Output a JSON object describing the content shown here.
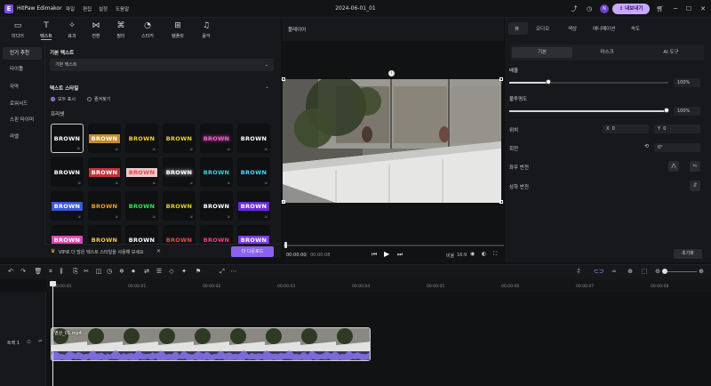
{
  "app": {
    "name": "HitPaw Edimakor",
    "menu": [
      "파일",
      "편집",
      "설정",
      "도움말"
    ],
    "doc_title": "2024-06-01_01",
    "avatar_initial": "N",
    "export_label": "내보내기"
  },
  "tool_tabs": [
    {
      "label": "미디어",
      "icon": "media-icon"
    },
    {
      "label": "텍스트",
      "icon": "text-icon",
      "active": true
    },
    {
      "label": "효과",
      "icon": "effects-icon"
    },
    {
      "label": "전환",
      "icon": "transition-icon"
    },
    {
      "label": "필터",
      "icon": "filter-icon"
    },
    {
      "label": "스티커",
      "icon": "sticker-icon"
    },
    {
      "label": "템플릿",
      "icon": "template-icon"
    },
    {
      "label": "음악",
      "icon": "music-icon"
    }
  ],
  "categories": [
    "인기 추천",
    "타이틀",
    "자막",
    "로워서드",
    "스핀 타이머",
    "라벨"
  ],
  "text_panel": {
    "basic_title": "기본 텍스트",
    "basic_value": "기본 텍스트",
    "style_title": "텍스트 스타일",
    "radio_all": "모두 표시",
    "radio_fav": "즐겨찾기",
    "preset_title": "프리셋",
    "preset_text": "BROWN",
    "vip_text": "VIP로 더 많은 텍스트 스타일을 사용해 보세요",
    "more_label": "더 다운로드"
  },
  "presets": [
    {
      "color": "#ffffff",
      "bg": "#0f1012",
      "glow": false
    },
    {
      "color": "#ffffff",
      "bg": "#c58a2c",
      "glow": false
    },
    {
      "color": "#f5d23a",
      "bg": "#0f1012",
      "glow": false
    },
    {
      "color": "#f0d530",
      "bg": "#0f1012",
      "glow": false
    },
    {
      "color": "#f05ac8",
      "bg": "#0f1012",
      "glow": true
    },
    {
      "color": "#ffffff",
      "bg": "#0f1012",
      "glow": false
    },
    {
      "color": "#ffffff",
      "bg": "#0f1012",
      "glow": false
    },
    {
      "color": "#ffffff",
      "bg": "#c0353a",
      "glow": false
    },
    {
      "color": "#e04a4a",
      "bg": "#f0c8c8",
      "glow": false
    },
    {
      "color": "#ffffff",
      "bg": "#0f1012",
      "glow": true
    },
    {
      "color": "#30d8e8",
      "bg": "#0f1012",
      "glow": false
    },
    {
      "color": "#5ad0ff",
      "bg": "#0f1012",
      "glow": false
    },
    {
      "color": "#ffffff",
      "bg": "#3a58d8",
      "glow": false
    },
    {
      "color": "#f0a020",
      "bg": "#0f1012",
      "glow": false
    },
    {
      "color": "#3fe050",
      "bg": "#0f1012",
      "glow": false
    },
    {
      "color": "#e8d030",
      "bg": "#0f1012",
      "glow": false
    },
    {
      "color": "#ffffff",
      "bg": "#0f1012",
      "glow": false
    },
    {
      "color": "#ffffff",
      "bg": "#6a2ad8",
      "glow": false
    },
    {
      "color": "#ffffff",
      "bg": "#d84ab0",
      "glow": false
    },
    {
      "color": "#f0d040",
      "bg": "#0f1012",
      "glow": false
    },
    {
      "color": "#ffffff",
      "bg": "#0f1012",
      "glow": false
    },
    {
      "color": "#e05050",
      "bg": "#0f1012",
      "glow": false
    },
    {
      "color": "#ff3a8a",
      "bg": "#0f1012",
      "glow": false
    },
    {
      "color": "#ffffff",
      "bg": "#7a3ae8",
      "glow": false
    }
  ],
  "player": {
    "title": "플레이어",
    "time_current": "00:00:00",
    "time_total": "00:00:08",
    "ratio_label": "비율",
    "ratio_value": "16:9",
    "progress": 0.0
  },
  "inspector": {
    "tabs": [
      "뷰",
      "오디오",
      "색상",
      "애니메이션",
      "속도"
    ],
    "sub_tabs": [
      "기본",
      "마스크",
      "AI 도구"
    ],
    "scale_label": "배율",
    "scale_value": "100%",
    "scale_fraction": 1.0,
    "opacity_label": "불투명도",
    "opacity_value": "100%",
    "opacity_fraction": 1.0,
    "position_label": "위치",
    "x_label": "X",
    "x_value": "0",
    "y_label": "Y",
    "y_value": "0",
    "rotate_label": "회전",
    "rotate_value": "0°",
    "flip_h_label": "좌우 반전",
    "flip_v_label": "상하 반전",
    "reset_label": "초기화"
  },
  "timeline": {
    "ticks": [
      "00:00:00",
      "00:00:01",
      "00:00:02",
      "00:00:03",
      "00:00:04",
      "00:00:05",
      "00:00:06",
      "00:00:07",
      "00:00:08"
    ],
    "track_label": "트랙 1",
    "clip_name": "영상_01.mp4"
  },
  "colors": {
    "accent": "#b995ff",
    "accent_button": "#8b62f0",
    "export_bg": "#c9a8ff"
  }
}
